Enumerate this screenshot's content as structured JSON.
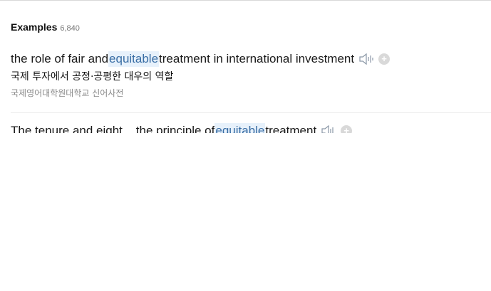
{
  "examples": {
    "title": "Examples",
    "count": "6,840",
    "items": [
      {
        "pre": "the role of fair and ",
        "highlight": "equitable",
        "post": " treatment in international investment",
        "translation": "국제 투자에서 공정·공평한 대우의 역할",
        "source": "국제영어대학원대학교 신어사전",
        "speaker_icon": "speaker-icon",
        "add_icon": "plus-icon"
      },
      {
        "pre": "The tenure and eight... the principle of ",
        "highlight": "equitable",
        "post": " treatment",
        "speaker_icon": "speaker-icon",
        "add_icon": "plus-icon"
      }
    ]
  },
  "colors": {
    "highlight_bg": "#e7f1fb",
    "highlight_text": "#3a6ea5",
    "muted_text": "#888888"
  }
}
